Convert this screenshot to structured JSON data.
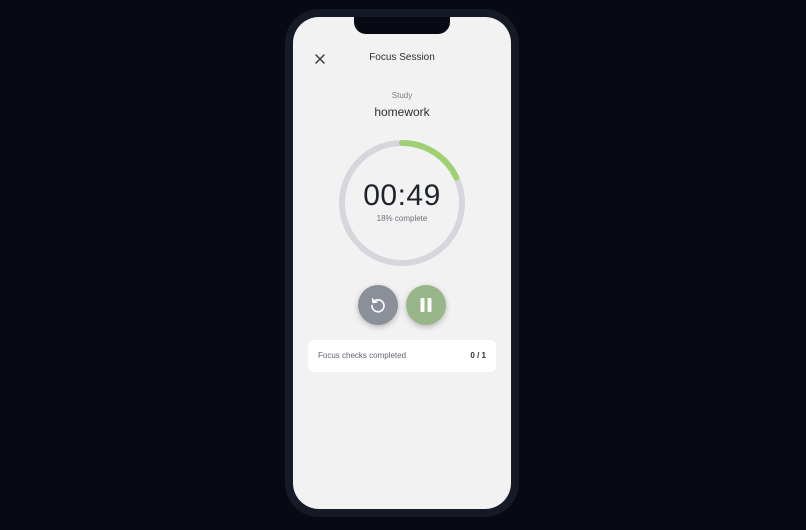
{
  "header": {
    "title": "Focus Session",
    "close_icon": "close-icon"
  },
  "session": {
    "category": "Study",
    "task": "homework",
    "timer": "00:49",
    "progress_text": "18% complete",
    "progress_fraction": 0.18
  },
  "controls": {
    "reset_icon": "reset-icon",
    "pause_icon": "pause-icon"
  },
  "checks": {
    "label": "Focus checks completed",
    "value": "0 / 1"
  },
  "colors": {
    "ring_track": "#d5d7dc",
    "ring_progress": "#9fd072",
    "reset_button": "#8b8f9a",
    "pause_button": "#98b689"
  }
}
